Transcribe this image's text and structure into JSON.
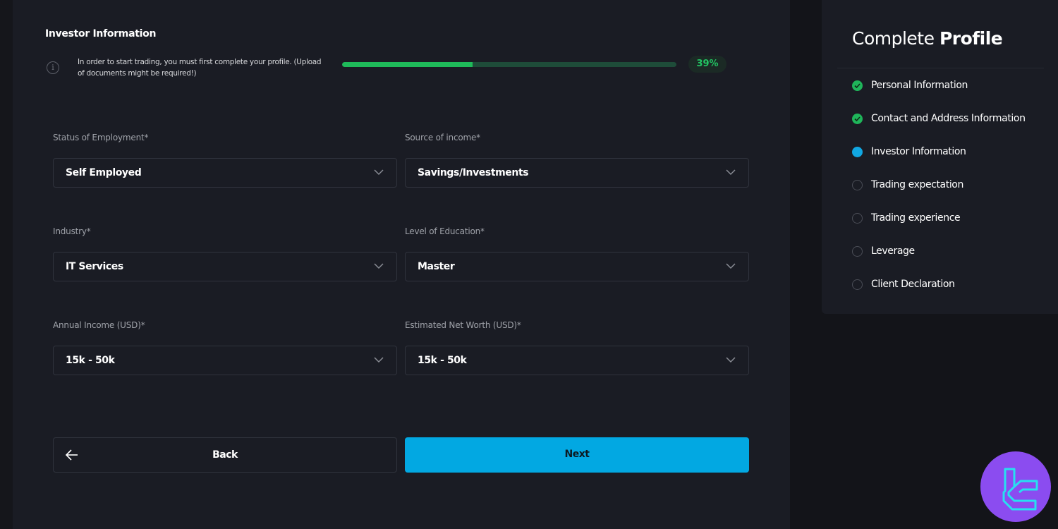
{
  "form": {
    "title": "Investor Information",
    "info_icon": "info-circle-icon",
    "info_text": "In order to start trading, you must first complete your profile. (Upload of documents might be required!)",
    "progress": {
      "percent": 39,
      "label": "39%",
      "fill_color": "#1fba5a"
    },
    "fields": [
      {
        "label": "Status of Employment*",
        "value": "Self Employed"
      },
      {
        "label": "Source of income*",
        "value": "Savings/Investments"
      },
      {
        "label": "Industry*",
        "value": "IT Services"
      },
      {
        "label": "Level of Education*",
        "value": "Master"
      },
      {
        "label": "Annual Income (USD)*",
        "value": "15k - 50k"
      },
      {
        "label": "Estimated Net Worth (USD)*",
        "value": "15k - 50k"
      }
    ],
    "back_label": "Back",
    "next_label": "Next",
    "accent_color": "#02a8e2"
  },
  "sidebar": {
    "title_light": "Complete",
    "title_bold": "Profile",
    "steps": [
      {
        "label": "Personal Information",
        "status": "done"
      },
      {
        "label": "Contact and Address Information",
        "status": "done"
      },
      {
        "label": "Investor Information",
        "status": "current"
      },
      {
        "label": "Trading expectation",
        "status": "todo"
      },
      {
        "label": "Trading experience",
        "status": "todo"
      },
      {
        "label": "Leverage",
        "status": "todo"
      },
      {
        "label": "Client Declaration",
        "status": "todo"
      }
    ]
  }
}
